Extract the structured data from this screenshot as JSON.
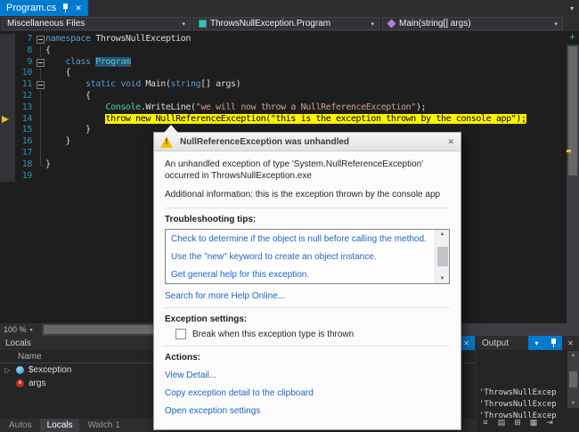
{
  "colors": {
    "accent": "#007ACC",
    "editor_background": "#1E1E1E",
    "current_statement_highlight": "#FFF100",
    "link": "#2364C4"
  },
  "icons": {
    "close": "✕",
    "chevron_down": "▾",
    "scroll_up": "▲",
    "scroll_down": "▼",
    "expander": "▷",
    "split_plus": "+"
  },
  "tab_bar": {
    "active_tab": "Program.cs"
  },
  "nav_bar": {
    "scope_dropdown": "Miscellaneous Files",
    "type_dropdown": "ThrowsNullException.Program",
    "member_dropdown": "Main(string[] args)"
  },
  "editor": {
    "zoom_level": "100 %",
    "lines": [
      {
        "num": "7",
        "fold": "box",
        "tokens": [
          {
            "c": "kw",
            "t": "namespace"
          },
          {
            "c": "pl",
            "t": " ThrowsNullException"
          }
        ]
      },
      {
        "num": "8",
        "fold": "line",
        "tokens": [
          {
            "c": "pl",
            "t": "{"
          }
        ]
      },
      {
        "num": "9",
        "fold": "box",
        "tokens": [
          {
            "c": "pl",
            "t": "    "
          },
          {
            "c": "kw",
            "t": "class"
          },
          {
            "c": "pl",
            "t": " "
          },
          {
            "c": "type-hl",
            "t": "Program"
          }
        ]
      },
      {
        "num": "10",
        "fold": "line",
        "tokens": [
          {
            "c": "pl",
            "t": "    {"
          }
        ]
      },
      {
        "num": "11",
        "fold": "box",
        "tokens": [
          {
            "c": "pl",
            "t": "        "
          },
          {
            "c": "kw",
            "t": "static"
          },
          {
            "c": "pl",
            "t": " "
          },
          {
            "c": "kw",
            "t": "void"
          },
          {
            "c": "pl",
            "t": " Main("
          },
          {
            "c": "kw",
            "t": "string"
          },
          {
            "c": "pl",
            "t": "[] args)"
          }
        ]
      },
      {
        "num": "12",
        "fold": "line",
        "tokens": [
          {
            "c": "pl",
            "t": "        {"
          }
        ]
      },
      {
        "num": "13",
        "fold": "line",
        "tokens": [
          {
            "c": "pl",
            "t": "            "
          },
          {
            "c": "type",
            "t": "Console"
          },
          {
            "c": "pl",
            "t": ".WriteLine("
          },
          {
            "c": "str",
            "t": "\"we will now throw a NullReferenceException\""
          },
          {
            "c": "pl",
            "t": ");"
          }
        ]
      },
      {
        "num": "14",
        "fold": "line",
        "current": true,
        "tokens": [
          {
            "c": "pl",
            "t": "            "
          },
          {
            "c": "hl",
            "t": "throw new NullReferenceException(\"this is the exception thrown by the console app\")"
          },
          {
            "c": "hl sq",
            "t": ";"
          }
        ]
      },
      {
        "num": "15",
        "fold": "line",
        "tokens": [
          {
            "c": "pl",
            "t": "        }"
          }
        ]
      },
      {
        "num": "16",
        "fold": "line",
        "tokens": [
          {
            "c": "pl",
            "t": "    }"
          }
        ]
      },
      {
        "num": "17",
        "fold": "line",
        "tokens": []
      },
      {
        "num": "18",
        "fold": "end",
        "tokens": [
          {
            "c": "pl",
            "t": "}"
          }
        ]
      },
      {
        "num": "19",
        "fold": "none",
        "tokens": []
      }
    ]
  },
  "exception_dialog": {
    "title": "NullReferenceException was unhandled",
    "message": "An unhandled exception of type 'System.NullReferenceException' occurred in ThrowsNullException.exe",
    "additional_info": "Additional information: this is the exception thrown by the console app",
    "troubleshooting_label": "Troubleshooting tips:",
    "troubleshooting_tips": [
      "Check to determine if the object is null before calling the method.",
      "Use the \"new\" keyword to create an object instance.",
      "Get general help for this exception."
    ],
    "search_link": "Search for more Help Online...",
    "exception_settings_label": "Exception settings:",
    "break_checkbox_label": "Break when this exception type is thrown",
    "break_checkbox_checked": false,
    "actions_label": "Actions:",
    "action_links": [
      "View Detail...",
      "Copy exception detail to the clipboard",
      "Open exception settings"
    ]
  },
  "locals_panel": {
    "title": "Locals",
    "name_column": "Name",
    "rows": [
      {
        "name": "$exception",
        "icon": "exception",
        "expandable": true
      },
      {
        "name": "args",
        "icon": "null-value",
        "expandable": false
      }
    ],
    "tabs": [
      {
        "label": "Autos",
        "cls": ""
      },
      {
        "label": "Locals",
        "cls": "active"
      },
      {
        "label": "Watch 1",
        "cls": ""
      }
    ]
  },
  "output_panel": {
    "title": "Output",
    "lines": [
      "'ThrowsNullExcep",
      "'ThrowsNullExcep",
      "'ThrowsNullExcep"
    ],
    "toolbar_icons": [
      {
        "name": "output-source-icon",
        "glyph": "≡"
      },
      {
        "name": "find-message-icon",
        "glyph": "▤"
      },
      {
        "name": "clear-all-icon",
        "glyph": "⊞"
      },
      {
        "name": "word-wrap-icon",
        "glyph": "▦"
      },
      {
        "name": "autoscroll-icon",
        "glyph": "⇥"
      }
    ]
  }
}
